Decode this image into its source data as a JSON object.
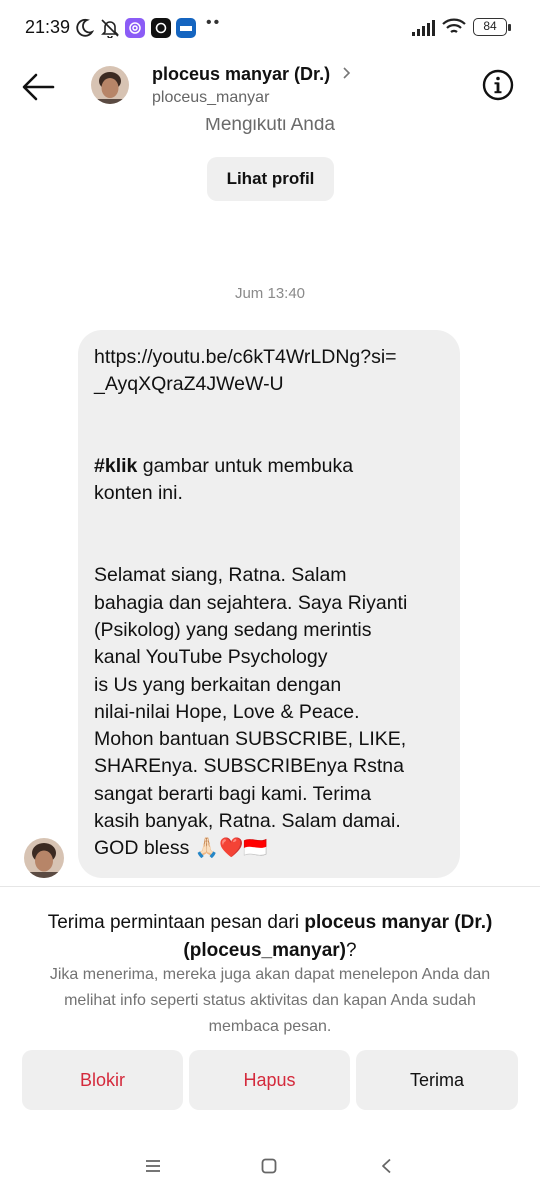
{
  "status_bar": {
    "time": "21:39",
    "battery": "84",
    "dots": "••"
  },
  "header": {
    "name": "ploceus manyar (Dr.)",
    "handle": "ploceus_manyar"
  },
  "profile": {
    "following_text": "Mengikuti Anda",
    "view_profile_label": "Lihat profil"
  },
  "conversation": {
    "timestamp": "Jum 13:40",
    "message": {
      "link_line1": "https://youtu.be/c6kT4WrLDNg?si=",
      "link_line2": "_AyqXQraZ4JWeW-U",
      "hashtag": "#klik",
      "hashtag_rest": " gambar untuk membuka",
      "hashtag_line2": "konten ini.",
      "body_lines": [
        "Selamat siang, Ratna. Salam",
        "bahagia dan sejahtera. Saya Riyanti",
        "(Psikolog)  yang sedang merintis",
        "kanal YouTube  Psychology",
        "is Us yang berkaitan dengan",
        "nilai-nilai Hope, Love & Peace.",
        "Mohon bantuan SUBSCRIBE, LIKE,",
        "SHAREnya. SUBSCRIBEnya Rstna",
        "sangat berarti bagi kami. Terima",
        "kasih banyak, Ratna. Salam damai."
      ],
      "last_line": "GOD bless 🙏🏻❤️🇮🇩"
    }
  },
  "request": {
    "title_prefix": "Terima permintaan pesan dari ",
    "title_name": "ploceus manyar (Dr.)",
    "title_handle": "(ploceus_manyar)",
    "title_suffix": "?",
    "description": "Jika menerima, mereka juga akan dapat menelepon Anda dan melihat info seperti status aktivitas dan kapan Anda sudah membaca pesan.",
    "block_label": "Blokir",
    "delete_label": "Hapus",
    "accept_label": "Terima"
  },
  "colors": {
    "danger": "#d42a3c",
    "bubble": "#efefef",
    "muted": "#737373"
  }
}
